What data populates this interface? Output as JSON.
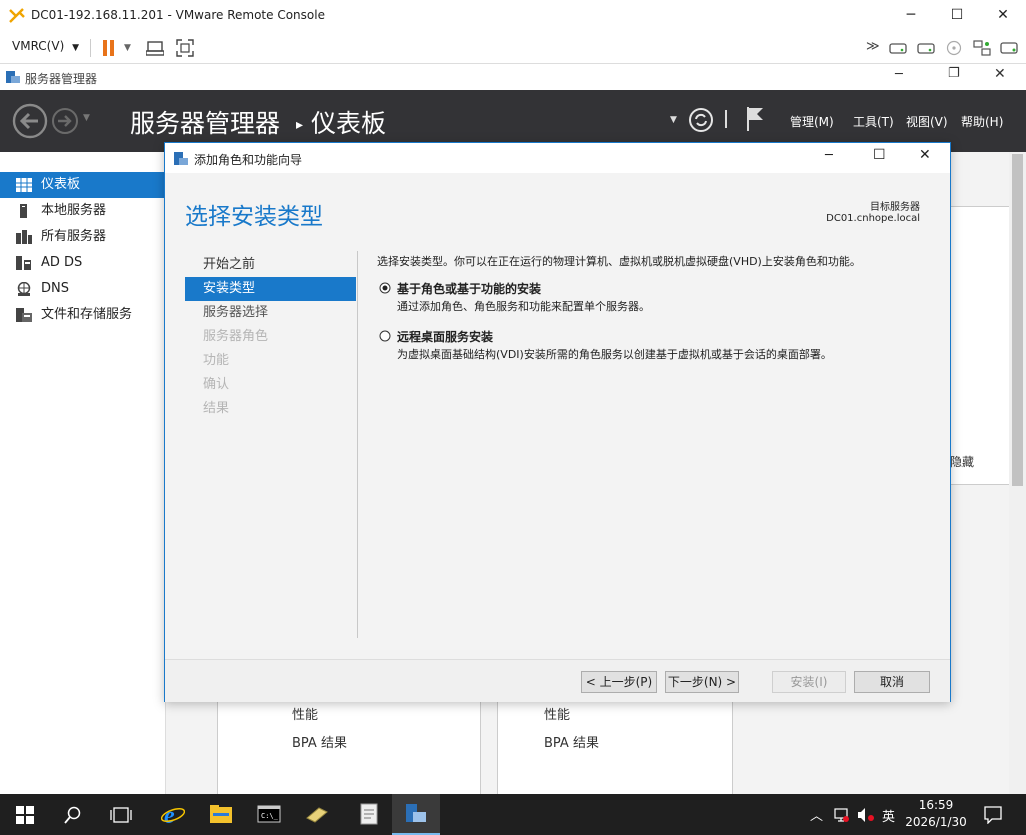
{
  "vmrc": {
    "title": "DC01-192.168.11.201 - VMware Remote Console",
    "menu_label": "VMRC(V)"
  },
  "sm": {
    "window_title": "服务器管理器",
    "breadcrumb_root": "服务器管理器",
    "breadcrumb_sep": "▸",
    "breadcrumb_page": "仪表板",
    "menus": [
      "管理(M)",
      "工具(T)",
      "视图(V)",
      "帮助(H)"
    ],
    "nav": [
      "仪表板",
      "本地服务器",
      "所有服务器",
      "AD DS",
      "DNS",
      "文件和存储服务"
    ],
    "bg_hidden_text": "隐藏",
    "tile1": [
      "性能",
      "BPA 结果"
    ],
    "tile2": [
      "性能",
      "BPA 结果"
    ]
  },
  "dialog": {
    "title": "添加角色和功能向导",
    "heading": "选择安装类型",
    "target_label": "目标服务器",
    "target_server": "DC01.cnhope.local",
    "steps": [
      "开始之前",
      "安装类型",
      "服务器选择",
      "服务器角色",
      "功能",
      "确认",
      "结果"
    ],
    "description": "选择安装类型。你可以在正在运行的物理计算机、虚拟机或脱机虚拟硬盘(VHD)上安装角色和功能。",
    "options": [
      {
        "label": "基于角色或基于功能的安装",
        "desc": "通过添加角色、角色服务和功能来配置单个服务器。",
        "selected": true
      },
      {
        "label": "远程桌面服务安装",
        "desc": "为虚拟桌面基础结构(VDI)安装所需的角色服务以创建基于虚拟机或基于会话的桌面部署。",
        "selected": false
      }
    ],
    "buttons": {
      "prev": "< 上一步(P)",
      "next": "下一步(N) >",
      "install": "安装(I)",
      "cancel": "取消"
    }
  },
  "taskbar": {
    "time": "16:59",
    "date": "2026/1/30",
    "ime": "英"
  },
  "colors": {
    "accent": "#1979ca",
    "header_bg": "#333336",
    "taskbar_bg": "#1f1f1f"
  }
}
